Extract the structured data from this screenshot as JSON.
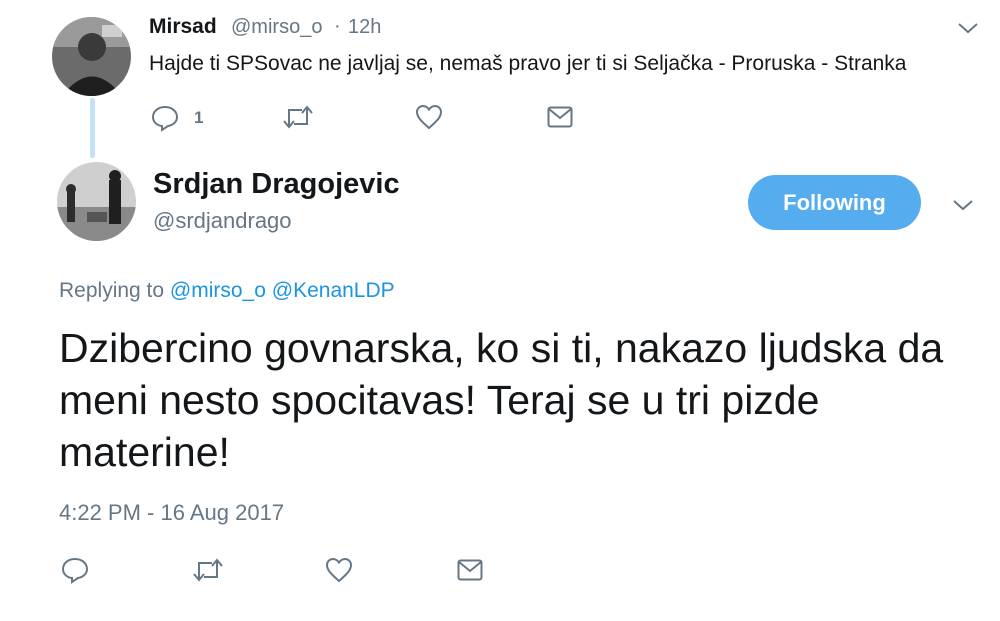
{
  "reply": {
    "name": "Mirsad",
    "handle": "@mirso_o",
    "dot": "·",
    "time": "12h",
    "text": "Hajde ti SPSovac ne javljaj se, nemaš pravo jer ti si Seljačka - Proruska - Stranka",
    "reply_count": "1"
  },
  "tweet": {
    "name": "Srdjan Dragojevic",
    "handle": "@srdjandrago",
    "follow_label": "Following",
    "replying_prefix": "Replying to",
    "mention1": "@mirso_o",
    "mention2": "@KenanLDP",
    "text": "Dzibercino govnarska, ko si ti, nakazo ljudska da meni nesto spocitavas! Teraj se u tri pizde materine!",
    "timestamp": "4:22 PM - 16 Aug 2017"
  },
  "colors": {
    "accent": "#55acee",
    "link": "#1b95e0",
    "muted": "#657786",
    "thread": "#c4e1f6"
  },
  "icons": [
    "reply-icon",
    "retweet-icon",
    "like-icon",
    "dm-icon",
    "chevron-down-icon"
  ]
}
